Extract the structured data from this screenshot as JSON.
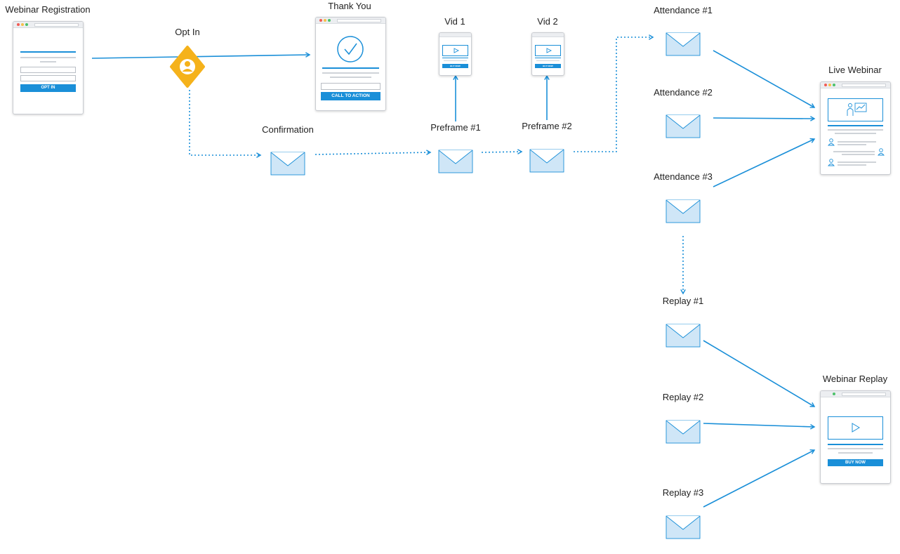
{
  "colors": {
    "accent": "#1a8fd8",
    "envelope_fill": "#cfe6f7",
    "envelope_stroke": "#1a8fd8",
    "optin_fill": "#f5b21b",
    "dot_red": "#f25c54",
    "dot_yellow": "#f7c04a",
    "dot_green": "#4cc26a"
  },
  "labels": {
    "webinar_registration": "Webinar Registration",
    "opt_in": "Opt In",
    "thank_you": "Thank You",
    "vid1": "Vid 1",
    "vid2": "Vid 2",
    "confirmation": "Confirmation",
    "preframe1": "Preframe #1",
    "preframe2": "Preframe #2",
    "attendance1": "Attendance #1",
    "attendance2": "Attendance #2",
    "attendance3": "Attendance #3",
    "live_webinar": "Live Webinar",
    "replay1": "Replay #1",
    "replay2": "Replay #2",
    "replay3": "Replay #3",
    "webinar_replay": "Webinar Replay"
  },
  "buttons": {
    "opt_in": "OPT IN",
    "call_to_action": "CALL TO ACTION",
    "vid1_buy": "BUY NOW",
    "vid2_buy": "BUY NOW",
    "replay_buy": "BUY NOW"
  },
  "icons": {
    "optin": "user-icon",
    "thank_you": "checkmark-circle-icon",
    "video": "play-icon",
    "email": "envelope-icon",
    "presenter": "presenter-chart-icon",
    "attendee": "person-icon"
  }
}
